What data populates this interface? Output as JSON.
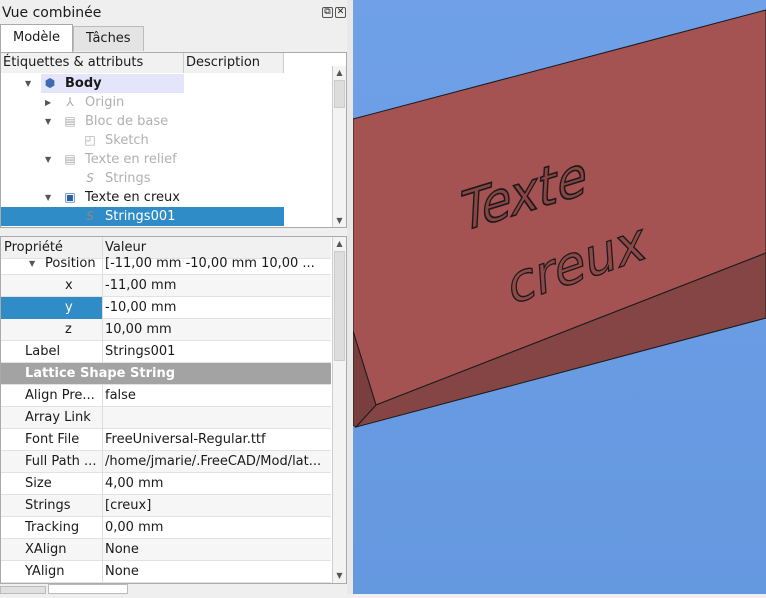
{
  "panel": {
    "title": "Vue combinée",
    "tabs": [
      {
        "label": "Modèle",
        "active": true
      },
      {
        "label": "Tâches",
        "active": false
      }
    ]
  },
  "tree": {
    "columns": [
      "Étiquettes & attributs",
      "Description"
    ],
    "items": [
      {
        "label": "Body",
        "icon": "body-icon",
        "expanded": true,
        "level": 0,
        "bold": true,
        "state": "active"
      },
      {
        "label": "Origin",
        "icon": "origin-axes-icon",
        "expanded": false,
        "level": 1,
        "state": "hidden"
      },
      {
        "label": "Bloc de base",
        "icon": "pad-icon",
        "expanded": true,
        "level": 1,
        "state": "hidden"
      },
      {
        "label": "Sketch",
        "icon": "sketch-icon",
        "level": 2,
        "state": "hidden"
      },
      {
        "label": "Texte en relief",
        "icon": "pad-icon",
        "expanded": true,
        "level": 1,
        "state": "hidden"
      },
      {
        "label": "Strings",
        "icon": "shapestring-icon",
        "level": 2,
        "state": "hidden"
      },
      {
        "label": "Texte en creux",
        "icon": "pocket-icon",
        "expanded": true,
        "level": 1,
        "state": "visible"
      },
      {
        "label": "Strings001",
        "icon": "shapestring-icon",
        "level": 2,
        "state": "selected"
      }
    ]
  },
  "properties": {
    "columns": [
      "Propriété",
      "Valeur"
    ],
    "rows": [
      {
        "name": "Position",
        "value": "[-11,00 mm  -10,00 mm  10,00 ...",
        "indent": 2,
        "expanded": true
      },
      {
        "name": "x",
        "value": "-11,00 mm",
        "indent": 3
      },
      {
        "name": "y",
        "value": "-10,00 mm",
        "indent": 3,
        "selected": true
      },
      {
        "name": "z",
        "value": "10,00 mm",
        "indent": 3
      },
      {
        "name": "Label",
        "value": "Strings001",
        "indent": 1
      },
      {
        "group": "Lattice Shape String"
      },
      {
        "name": "Align Pre...",
        "value": "false",
        "indent": 1
      },
      {
        "name": "Array Link",
        "value": "",
        "indent": 1
      },
      {
        "name": "Font File",
        "value": "FreeUniversal-Regular.ttf",
        "indent": 1
      },
      {
        "name": "Full Path ...",
        "value": "/home/jmarie/.FreeCAD/Mod/lat...",
        "indent": 1
      },
      {
        "name": "Size",
        "value": "4,00 mm",
        "indent": 1
      },
      {
        "name": "Strings",
        "value": "[creux]",
        "indent": 1
      },
      {
        "name": "Tracking",
        "value": "0,00 mm",
        "indent": 1
      },
      {
        "name": "XAlign",
        "value": "None",
        "indent": 1
      },
      {
        "name": "YAlign",
        "value": "None",
        "indent": 1
      }
    ]
  },
  "viewport": {
    "engraved": [
      "Texte",
      "creux"
    ],
    "colors": {
      "background": "#6b9ee6",
      "top_face": "#a55252",
      "side_face": "#864545",
      "edge": "#1a1a1a"
    }
  }
}
